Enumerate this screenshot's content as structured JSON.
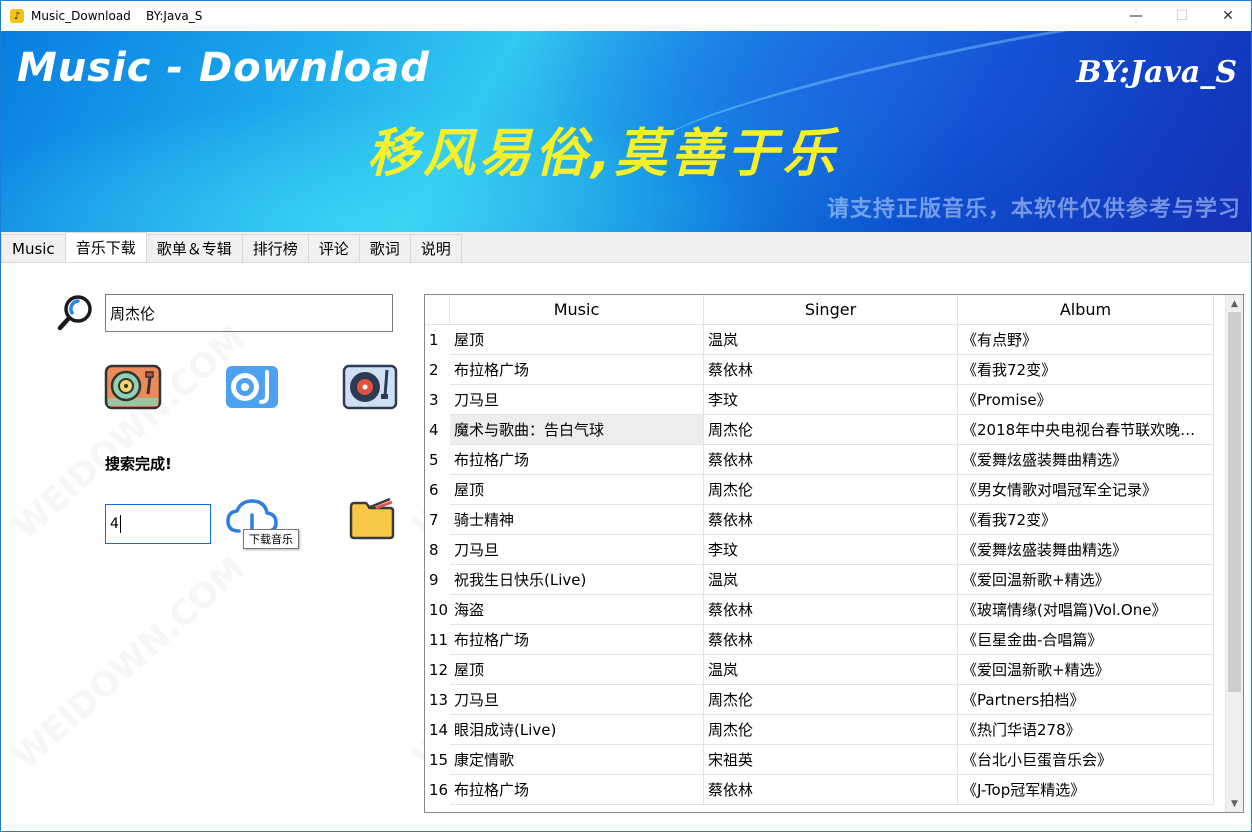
{
  "window": {
    "title": "Music_Download    BY:Java_S",
    "app_icon": "music-note-icon",
    "controls": {
      "minimize": "—",
      "maximize": "☐",
      "close": "✕"
    }
  },
  "banner": {
    "title": "Music - Download",
    "author": "BY:Java_S",
    "slogan": "移风易俗,莫善于乐",
    "notice": "请支持正版音乐，本软件仅供参考与学习"
  },
  "tabs": [
    {
      "label": "Music",
      "active": false
    },
    {
      "label": "音乐下载",
      "active": true
    },
    {
      "label": "歌单＆专辑",
      "active": false
    },
    {
      "label": "排行榜",
      "active": false
    },
    {
      "label": "评论",
      "active": false
    },
    {
      "label": "歌词",
      "active": false
    },
    {
      "label": "说明",
      "active": false
    }
  ],
  "search": {
    "icon": "search-icon",
    "value": "周杰伦"
  },
  "source_buttons": [
    {
      "icon": "turntable-icon"
    },
    {
      "icon": "music-player-icon"
    },
    {
      "icon": "record-player-icon"
    }
  ],
  "status": "搜索完成!",
  "download": {
    "count_value": "4",
    "icon": "cloud-download-icon",
    "tooltip": "下载音乐",
    "folder_icon": "folder-icon"
  },
  "table": {
    "columns": [
      "",
      "Music",
      "Singer",
      "Album"
    ],
    "selected_row": 4,
    "rows": [
      {
        "no": "1",
        "music": "屋顶",
        "singer": "温岚",
        "album": "《有点野》"
      },
      {
        "no": "2",
        "music": "布拉格广场",
        "singer": "蔡依林",
        "album": "《看我72变》"
      },
      {
        "no": "3",
        "music": "刀马旦",
        "singer": "李玟",
        "album": "《Promise》"
      },
      {
        "no": "4",
        "music": "魔术与歌曲：告白气球",
        "singer": "周杰伦",
        "album": "《2018年中央电视台春节联欢晚…"
      },
      {
        "no": "5",
        "music": "布拉格广场",
        "singer": "蔡依林",
        "album": "《爱舞炫盛装舞曲精选》"
      },
      {
        "no": "6",
        "music": "屋顶",
        "singer": "周杰伦",
        "album": "《男女情歌对唱冠军全记录》"
      },
      {
        "no": "7",
        "music": "骑士精神",
        "singer": "蔡依林",
        "album": "《看我72变》"
      },
      {
        "no": "8",
        "music": "刀马旦",
        "singer": "李玟",
        "album": "《爱舞炫盛装舞曲精选》"
      },
      {
        "no": "9",
        "music": "祝我生日快乐(Live)",
        "singer": "温岚",
        "album": "《爱回温新歌+精选》"
      },
      {
        "no": "10",
        "music": "海盗",
        "singer": "蔡依林",
        "album": "《玻璃情缘(对唱篇)Vol.One》"
      },
      {
        "no": "11",
        "music": "布拉格广场",
        "singer": "蔡依林",
        "album": "《巨星金曲-合唱篇》"
      },
      {
        "no": "12",
        "music": "屋顶",
        "singer": "温岚",
        "album": "《爱回温新歌+精选》"
      },
      {
        "no": "13",
        "music": "刀马旦",
        "singer": "周杰伦",
        "album": "《Partners拍档》"
      },
      {
        "no": "14",
        "music": "眼泪成诗(Live)",
        "singer": "周杰伦",
        "album": "《热门华语278》"
      },
      {
        "no": "15",
        "music": "康定情歌",
        "singer": "宋祖英",
        "album": "《台北小巨蛋音乐会》"
      },
      {
        "no": "16",
        "music": "布拉格广场",
        "singer": "蔡依林",
        "album": "《J-Top冠军精选》"
      }
    ]
  },
  "scrollbar": {
    "up": "▲",
    "down": "▼"
  },
  "watermark": "WEIDOWN.COM"
}
